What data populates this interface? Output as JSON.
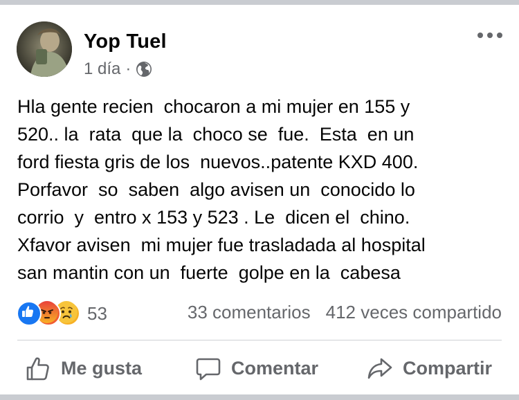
{
  "post": {
    "author": "Yop Tuel",
    "time": "1 día",
    "separator": "·",
    "audience_icon": "globe-icon",
    "text": "Hla gente recien  chocaron a mi mujer en 155 y\n520.. la  rata  que la  choco se  fue.  Esta  en un\nford fiesta gris de los  nuevos..patente KXD 400.\nPorfavor  so  saben  algo avisen un  conocido lo\ncorrio  y  entro x 153 y 523 . Le  dicen el  chino.\nXfavor avisen  mi mujer fue trasladada al hospital\nsan mantin con un  fuerte  golpe en la  cabesa"
  },
  "engagement": {
    "reaction_icons": [
      "like-icon",
      "angry-icon",
      "sad-icon"
    ],
    "reaction_count": "53",
    "comments": "33 comentarios",
    "shares": "412 veces compartido"
  },
  "actions": {
    "like": "Me gusta",
    "comment": "Comentar",
    "share": "Compartir"
  },
  "colors": {
    "text": "#050505",
    "secondary": "#65676b",
    "like_blue": "#1877f2",
    "angry_orange": "#f15c32",
    "sad_yellow": "#f7b125",
    "divider": "#ced0d4"
  }
}
